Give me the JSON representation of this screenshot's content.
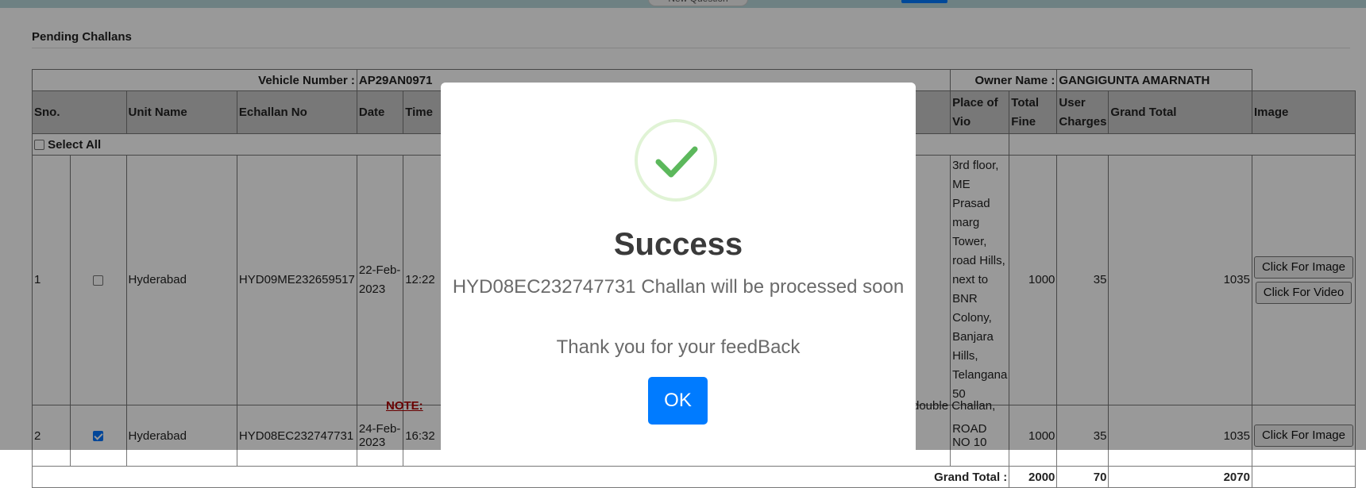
{
  "header": {
    "pill_label": "New Question"
  },
  "section": {
    "title": "Pending Challans"
  },
  "vehicle": {
    "number_label": "Vehicle Number :",
    "number": "AP29AN0971",
    "owner_label": "Owner Name :",
    "owner": "GANGIGUNTA AMARNATH"
  },
  "table": {
    "headers": {
      "sno": "Sno.",
      "unit_name": "Unit Name",
      "echallan_no": "Echallan No",
      "date": "Date",
      "time": "Time",
      "place": "Place of Vio",
      "total_fine": "Total Fine",
      "user_charges": "User Charges",
      "grand_total": "Grand Total",
      "image": "Image"
    },
    "select_all_label": "Select All",
    "rows": [
      {
        "sno": "1",
        "checked": false,
        "unit": "Hyderabad",
        "echallan": "HYD09ME232659517",
        "date": "22-Feb-2023",
        "time": "12:22",
        "place": "3rd floor, ME Prasad marg Tower, road Hills, next to BNR Colony, Banjara Hills, Telangana 50",
        "total_fine": "1000",
        "user_charges": "35",
        "grand_total": "1035",
        "image_button": "Click For Image",
        "video_button": "Click For Video"
      },
      {
        "sno": "2",
        "checked": true,
        "unit": "Hyderabad",
        "echallan": "HYD08EC232747731",
        "date": "24-Feb-2023",
        "time": "16:32",
        "place": "ROAD NO 10",
        "total_fine": "1000",
        "user_charges": "35",
        "grand_total": "1035",
        "image_button": "Click For Image"
      }
    ],
    "grand_total_label": "Grand Total :",
    "totals": {
      "total_fine": "2000",
      "user_charges": "70",
      "grand_total": "2070"
    }
  },
  "note": {
    "label": "NOTE:",
    "text": "double Challan,"
  },
  "modal": {
    "title": "Success",
    "message": "HYD08EC232747731 Challan will be processed soon",
    "thanks": "Thank you for your feedBack",
    "ok_label": "OK",
    "icon": "check-icon",
    "accent_color": "#007bff",
    "success_color": "#5cb85c"
  }
}
